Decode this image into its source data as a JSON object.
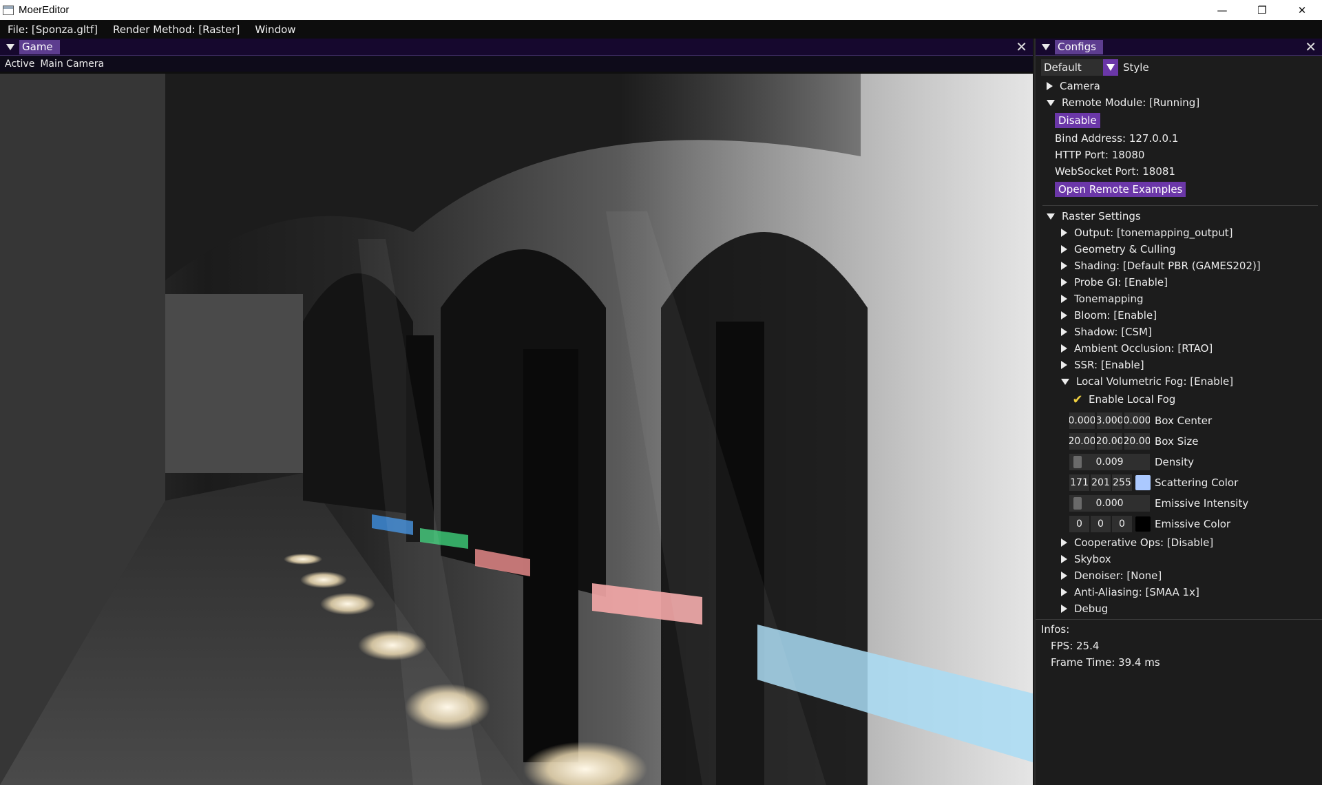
{
  "window": {
    "title": "MoerEditor",
    "minimize": "—",
    "restore": "❐",
    "close": "✕"
  },
  "menu": {
    "items": [
      "File: [Sponza.gltf]",
      "Render Method: [Raster]",
      "Window"
    ]
  },
  "game_panel": {
    "tab": "Game",
    "close": "✕",
    "subbar": {
      "active": "Active",
      "camera": "Main Camera"
    }
  },
  "config_panel": {
    "tab": "Configs",
    "close": "✕",
    "style_select": {
      "value": "Default",
      "label": "Style"
    },
    "camera": "Camera",
    "remote": {
      "header": "Remote Module: [Running]",
      "disable_button": "Disable",
      "bind_address": "Bind Address: 127.0.0.1",
      "http_port": "HTTP Port: 18080",
      "websocket_port": "WebSocket Port: 18081",
      "open_examples_button": "Open Remote Examples"
    },
    "raster": {
      "header": "Raster Settings",
      "items": [
        "Output: [tonemapping_output]",
        "Geometry & Culling",
        "Shading: [Default PBR (GAMES202)]",
        "Probe GI: [Enable]",
        "Tonemapping",
        "Bloom: [Enable]",
        "Shadow: [CSM]",
        "Ambient Occlusion: [RTAO]",
        "SSR: [Enable]"
      ],
      "fog": {
        "header": "Local Volumetric Fog: [Enable]",
        "enable_label": "Enable Local Fog",
        "enabled": true,
        "box_center": {
          "values": [
            "0.000",
            "3.000",
            "0.000"
          ],
          "label": "Box Center"
        },
        "box_size": {
          "values": [
            "20.00",
            "20.00",
            "20.00"
          ],
          "label": "Box Size"
        },
        "density": {
          "value": "0.009",
          "label": "Density"
        },
        "scattering": {
          "values": [
            "171",
            "201",
            "255"
          ],
          "label": "Scattering Color",
          "color": "#abc9ff"
        },
        "emissive_intensity": {
          "value": "0.000",
          "label": "Emissive Intensity"
        },
        "emissive_color": {
          "values": [
            "0",
            "0",
            "0"
          ],
          "label": "Emissive Color",
          "color": "#000000"
        }
      },
      "items_after": [
        "Cooperative Ops: [Disable]",
        "Skybox",
        "Denoiser: [None]",
        "Anti-Aliasing: [SMAA 1x]",
        "Debug"
      ]
    },
    "infos": {
      "header": "Infos:",
      "fps": "FPS: 25.4",
      "frame_time": "Frame Time: 39.4 ms"
    }
  },
  "colors": {
    "accent_purple": "#6b37a8",
    "tab_purple": "#5d3d8f",
    "header_dark_purple": "#16082e"
  }
}
